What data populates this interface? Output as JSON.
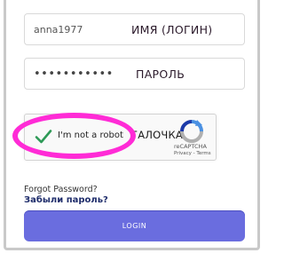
{
  "form": {
    "username": {
      "value": "anna1977",
      "annotation": "ИМЯ (ЛОГИН)"
    },
    "password": {
      "value": "•••••••••••",
      "annotation": "ПАРОЛЬ"
    },
    "captcha": {
      "label": "I'm not a robot",
      "annotation": "ГАЛОЧКА",
      "checked": true,
      "brand": "reCAPTCHA",
      "links": "Privacy - Terms"
    },
    "forgot_password_en": "Forgot Password?",
    "forgot_password_ru": "Забыли пароль?",
    "login_label": "LOGIN"
  },
  "colors": {
    "accent": "#6a6ddf",
    "highlight": "#ff2bd6",
    "checkmark": "#2e9a57",
    "link_ru": "#1f2d6b"
  }
}
